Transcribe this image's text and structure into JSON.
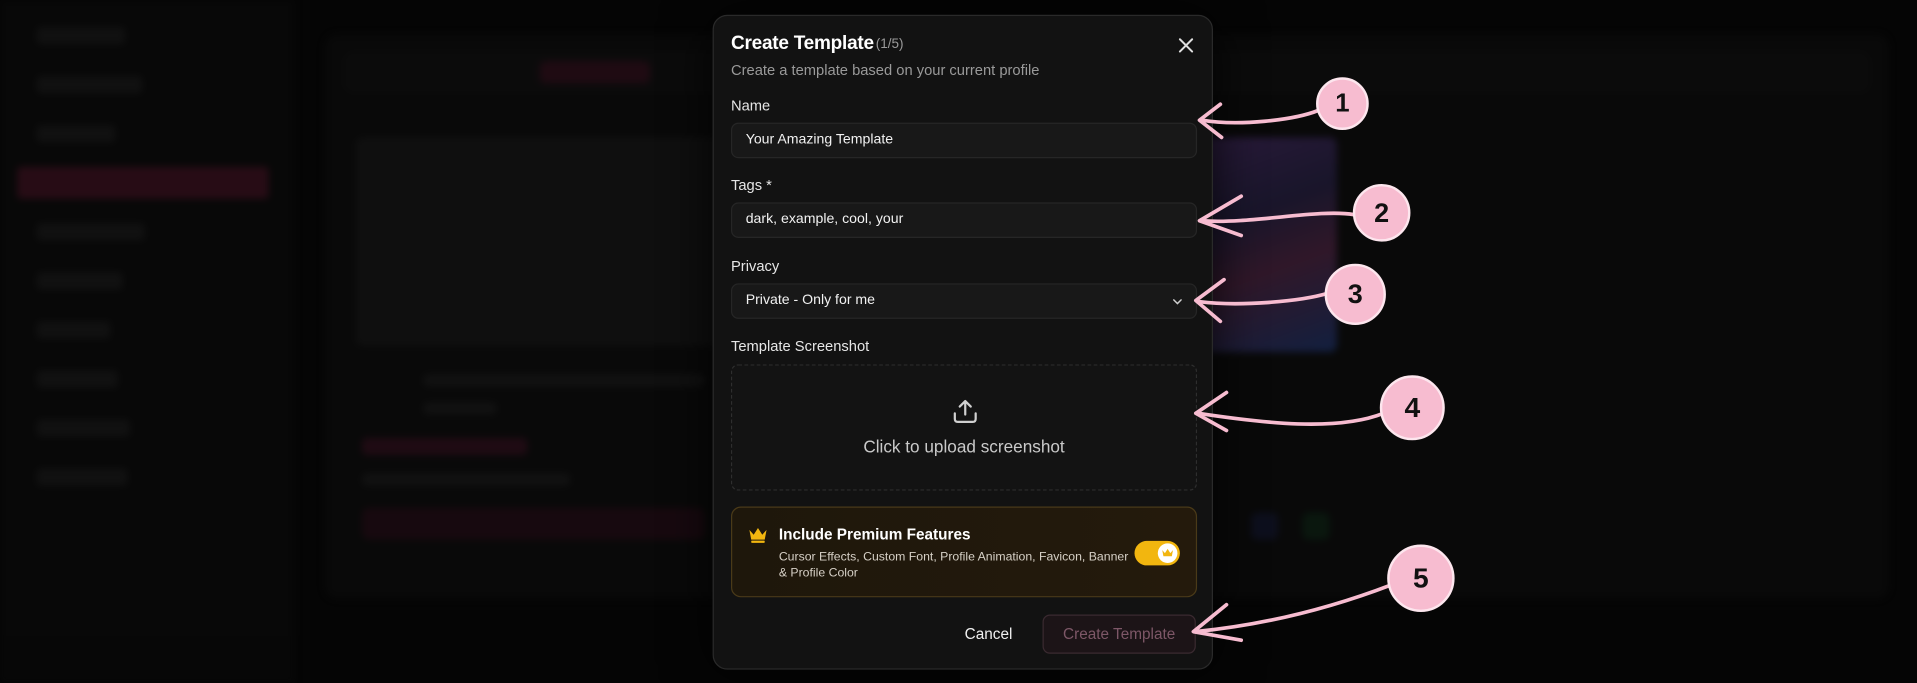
{
  "modal": {
    "title": "Create Template",
    "step": "(1/5)",
    "subtitle": "Create a template based on your current profile",
    "name_label": "Name",
    "name_value": "Your Amazing Template",
    "tags_label": "Tags *",
    "tags_value": "dark, example, cool, your",
    "privacy_label": "Privacy",
    "privacy_value": "Private - Only for me",
    "screenshot_label": "Template Screenshot",
    "upload_text": "Click to upload screenshot",
    "premium_title": "Include Premium Features",
    "premium_desc": "Cursor Effects, Custom Font, Profile Animation, Favicon, Banner & Profile Color",
    "premium_enabled": true,
    "cancel_label": "Cancel",
    "create_label": "Create Template"
  },
  "annotations": [
    "1",
    "2",
    "3",
    "4",
    "5"
  ],
  "colors": {
    "annotation": "#f7bcd0",
    "toggle_on": "#f2b60f",
    "premium_border": "#4a3a18",
    "create_text": "#7d5767"
  },
  "icons": [
    "close-icon",
    "chevron-down-icon",
    "upload-icon",
    "crown-icon"
  ]
}
